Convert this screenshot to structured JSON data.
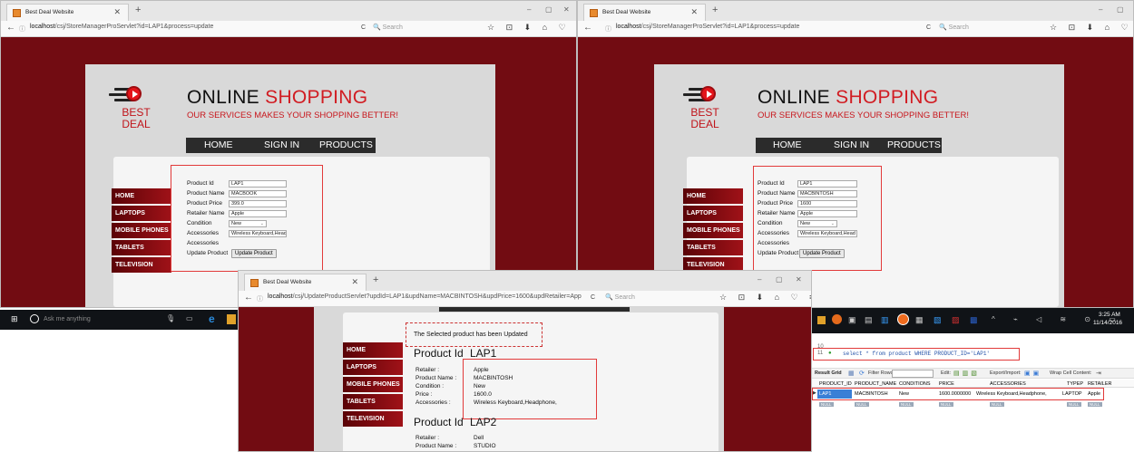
{
  "browser": {
    "tab_title": "Best Deal Website",
    "new_tab": "+",
    "win_min": "–",
    "win_max": "▢",
    "win_close": "✕",
    "back": "←",
    "info": "ⓘ",
    "reload": "C",
    "search_placeholder": "Search",
    "toolbar_icons": "☆ ⊡ ⬇ ⌂ ♡ ≡"
  },
  "win1": {
    "url_host": "localhost",
    "url_rest": "/csj/StoreManagerProServlet?id=LAP1&process=update"
  },
  "win2": {
    "url_host": "localhost",
    "url_rest": "/csj/StoreManagerProServlet?id=LAP1&process=update"
  },
  "win3": {
    "url_host": "localhost",
    "url_rest": "/csj/UpdateProductServlet?updId=LAP1&updName=MACBINTOSH&updPrice=1600&updRetailer=App"
  },
  "site": {
    "brand_top": "BEST",
    "brand_bottom": "DEAL",
    "title_part1": "ONLINE",
    "title_part2": "SHOPPING",
    "subtitle": "OUR SERVICES MAKES YOUR SHOPPING BETTER!",
    "menu": [
      "HOME",
      "SIGN IN",
      "PRODUCTS"
    ],
    "sidenav": [
      "HOME",
      "LAPTOPS",
      "MOBILE PHONES",
      "TABLETS",
      "TELEVISION"
    ]
  },
  "form_labels": {
    "id": "Product Id",
    "name": "Product Name",
    "price": "Product Price",
    "retailer": "Retailer Name",
    "condition": "Condition",
    "accessories": "Accessories",
    "accessories2": "Accessories",
    "update": "Update Product",
    "button": "Update Product"
  },
  "form1": {
    "id": "LAP1",
    "name": "MACBOOK",
    "price": "399.0",
    "retailer": "Apple",
    "condition": "New",
    "accessories": "Wireless Keyboard,Head"
  },
  "form2": {
    "id": "LAP1",
    "name": "MACBINTOSH",
    "price": "1600",
    "retailer": "Apple",
    "condition": "New",
    "accessories": "Wireless Keyboard,Head"
  },
  "result": {
    "message": "The Selected product has been Updated",
    "id_label": "Product Id",
    "id_value": "LAP1",
    "retailer_label": "Retailer :",
    "retailer_value": "Apple",
    "name_label": "Product Name :",
    "name_value": "MACBINTOSH",
    "condition_label": "Condition :",
    "condition_value": "New",
    "price_label": "Price :",
    "price_value": "1600.0",
    "accessories_label": "Accessories :",
    "accessories_value": "Wireless Keyboard,Headphone,",
    "id2_label": "Product Id",
    "id2_value": "LAP2",
    "retailer2_label": "Retailer :",
    "retailer2_value": "Dell",
    "name2_label": "Product Name :",
    "name2_value": "STUDIO"
  },
  "taskbar": {
    "search_placeholder": "Ask me anything",
    "time": "3:25 AM",
    "date": "11/14/2016"
  },
  "workbench": {
    "line_10": "10",
    "line_11": "11",
    "sql": "select * from product WHERE PRODUCT_ID='LAP1'",
    "result_grid": "Result Grid",
    "filter_rows": "Filter Rows:",
    "edit": "Edit:",
    "export": "Export/Import:",
    "wrap": "Wrap Cell Content:",
    "columns": [
      "PRODUCT_ID",
      "PRODUCT_NAME",
      "CONDITIONS",
      "PRICE",
      "ACCESSORIES",
      "TYPEP",
      "RETAILER"
    ],
    "row": [
      "LAP1",
      "MACBINTOSH",
      "New",
      "1600.0000000",
      "Wireless Keyboard,Headphone,",
      "LAPTOP",
      "Apple"
    ],
    "null_cell": "NULL"
  }
}
